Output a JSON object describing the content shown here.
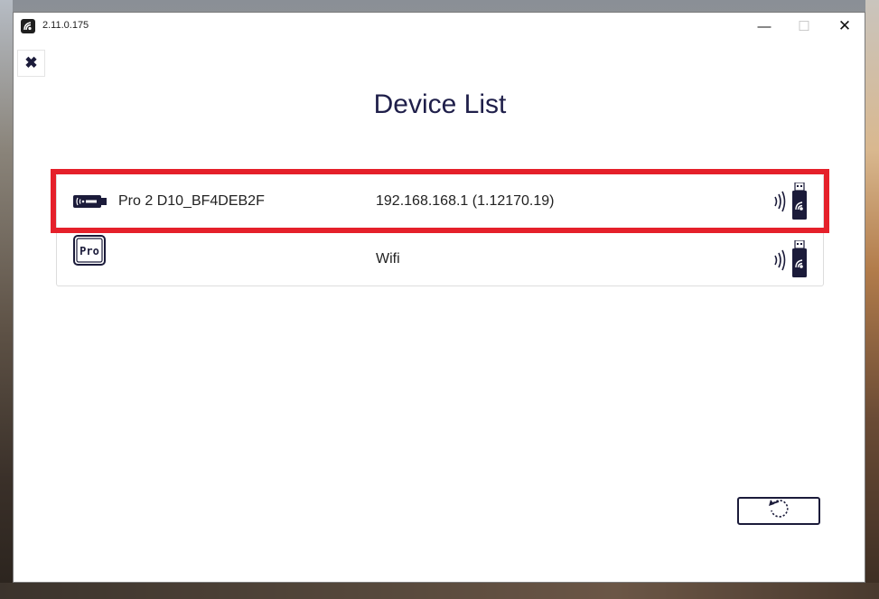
{
  "window": {
    "version": "2.11.0.175",
    "controls": {
      "minimize": "—",
      "maximize": "☐",
      "close": "✕"
    }
  },
  "close_button": {
    "label": "✖"
  },
  "page": {
    "title": "Device List"
  },
  "devices": [
    {
      "name": "Pro 2 D10_BF4DEB2F",
      "info": "192.168.168.1 (1.12170.19)",
      "icon": "usb-dongle-icon",
      "selected": true
    },
    {
      "name": "",
      "info": "Wifi",
      "icon": "pro-badge-icon",
      "selected": false
    }
  ],
  "refresh_button": {
    "icon": "refresh-icon"
  },
  "colors": {
    "accent": "#1f1f4a",
    "highlight": "#e5202a"
  },
  "icons": {
    "pro_badge_text": "Pro"
  }
}
